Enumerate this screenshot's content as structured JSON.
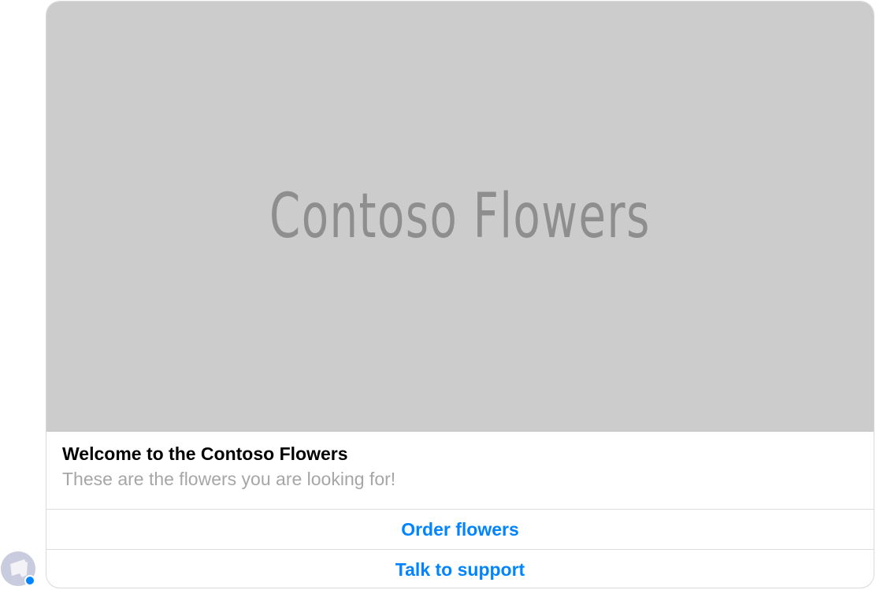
{
  "card": {
    "hero_text": "Contoso Flowers",
    "title": "Welcome to the Contoso Flowers",
    "subtitle": "These are the flowers you are looking for!",
    "buttons": [
      {
        "label": "Order flowers"
      },
      {
        "label": "Talk to support"
      }
    ]
  },
  "bot": {
    "avatar_icon": "bot-avatar-icon",
    "badge_icon": "messenger-badge-icon"
  },
  "colors": {
    "accent": "#0084ff",
    "hero_bg": "#cccccc",
    "hero_text": "#8e8e8e",
    "subtitle": "#a6a6a6"
  }
}
